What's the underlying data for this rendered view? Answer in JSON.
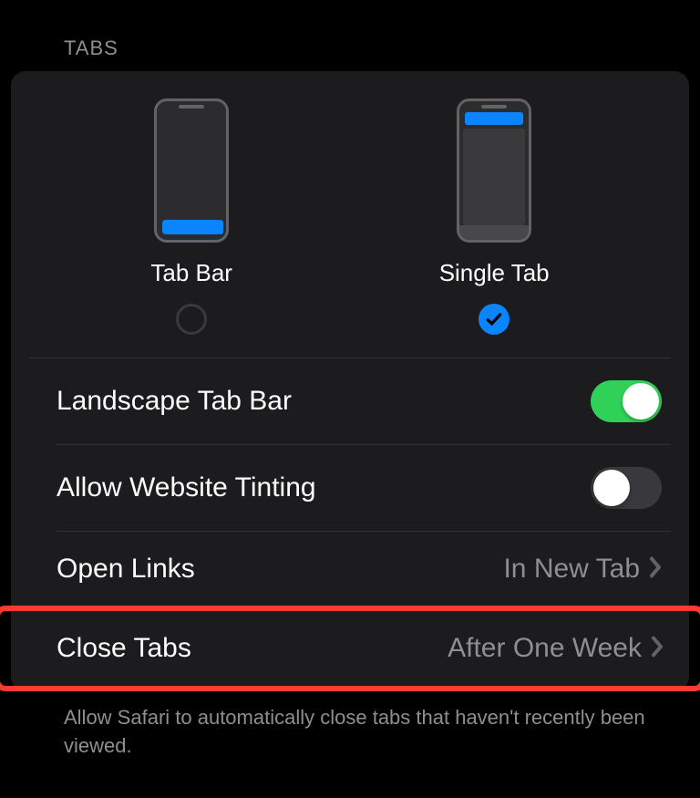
{
  "section": {
    "header": "TABS"
  },
  "layout": {
    "option_a": {
      "label": "Tab Bar",
      "selected": false
    },
    "option_b": {
      "label": "Single Tab",
      "selected": true
    }
  },
  "rows": {
    "landscape": {
      "label": "Landscape Tab Bar",
      "toggle": true
    },
    "tinting": {
      "label": "Allow Website Tinting",
      "toggle": false
    },
    "open_links": {
      "label": "Open Links",
      "value": "In New Tab"
    },
    "close_tabs": {
      "label": "Close Tabs",
      "value": "After One Week"
    }
  },
  "footer": "Allow Safari to automatically close tabs that haven't recently been viewed."
}
